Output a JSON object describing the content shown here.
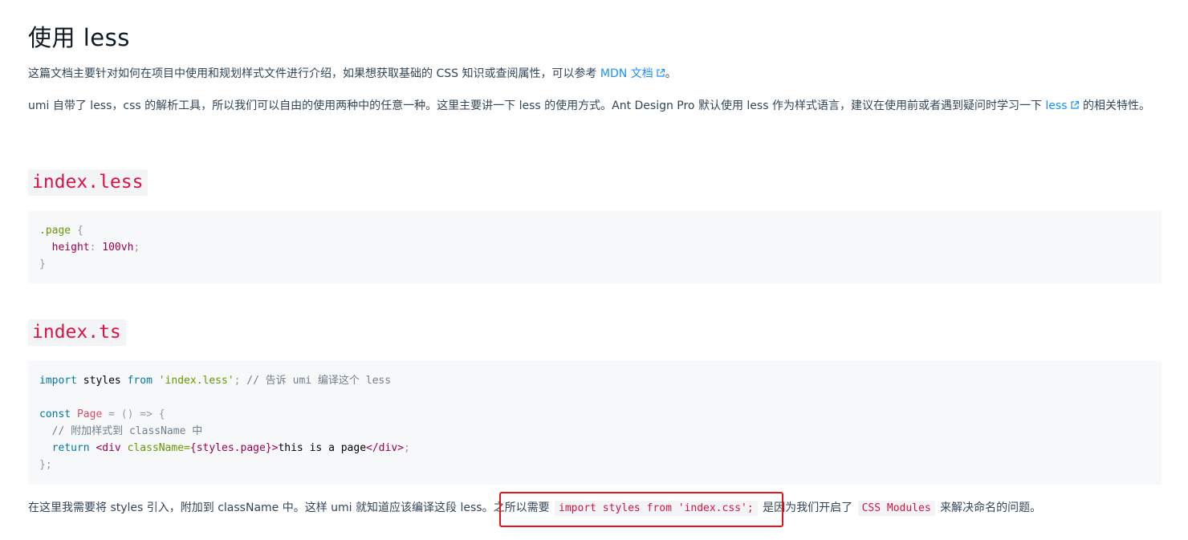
{
  "doc": {
    "title": "使用 less",
    "p1": {
      "text": "这篇文档主要针对如何在项目中使用和规划样式文件进行介绍，如果想获取基础的 CSS 知识或查阅属性，可以参考 ",
      "link": "MDN 文档",
      "tail": "。"
    },
    "p2": {
      "text": "umi 自带了 less，css 的解析工具，所以我们可以自由的使用两种中的任意一种。这里主要讲一下 less 的使用方式。Ant Design Pro 默认使用 less 作为样式语言，建议在使用前或者遇到疑问时学习一下 ",
      "link": "less",
      "tail": " 的相关特性。"
    },
    "section_less": {
      "heading": "index.less",
      "code": {
        "l1_selector": ".page",
        "l1_brace": " {",
        "l2_prop": "height",
        "l2_colon": ": ",
        "l2_value": "100vh",
        "l2_semi": ";",
        "l3_brace": "}"
      }
    },
    "section_ts": {
      "heading": "index.ts",
      "code": {
        "l1_import": "import",
        "l1_styles": " styles ",
        "l1_from": "from",
        "l1_space": " ",
        "l1_str": "'index.less'",
        "l1_semi": ";",
        "l1_comment": " // 告诉 umi 编译这个 less",
        "l3_const": "const",
        "l3_space": " ",
        "l3_page": "Page",
        "l3_rest": " = () => {",
        "l4_comment": "  // 附加样式到 className 中",
        "l5_indent": "  ",
        "l5_return": "return",
        "l5_space": " ",
        "l5_tag_open": "<div",
        "l5_space2": " ",
        "l5_attr": "className=",
        "l5_expr": "{styles.page}",
        "l5_gt": ">",
        "l5_text": "this is a page",
        "l5_tag_close": "</div>",
        "l5_semi": ";",
        "l6": "};"
      }
    },
    "p3": {
      "part1": "在这里我需要将 styles 引入，附加到 className 中。这样 umi 就知道应该编译这段 less。之所以需要 ",
      "code1": "import styles from 'index.css';",
      "part2": " 是因为我们开启了 ",
      "code2": "CSS Modules",
      "part3": " 来解决命名的问题。"
    }
  },
  "colors": {
    "link": "#1890ff",
    "code_red": "#d14",
    "highlight_border": "#e8141a"
  },
  "icons": [
    "external-link-icon"
  ]
}
